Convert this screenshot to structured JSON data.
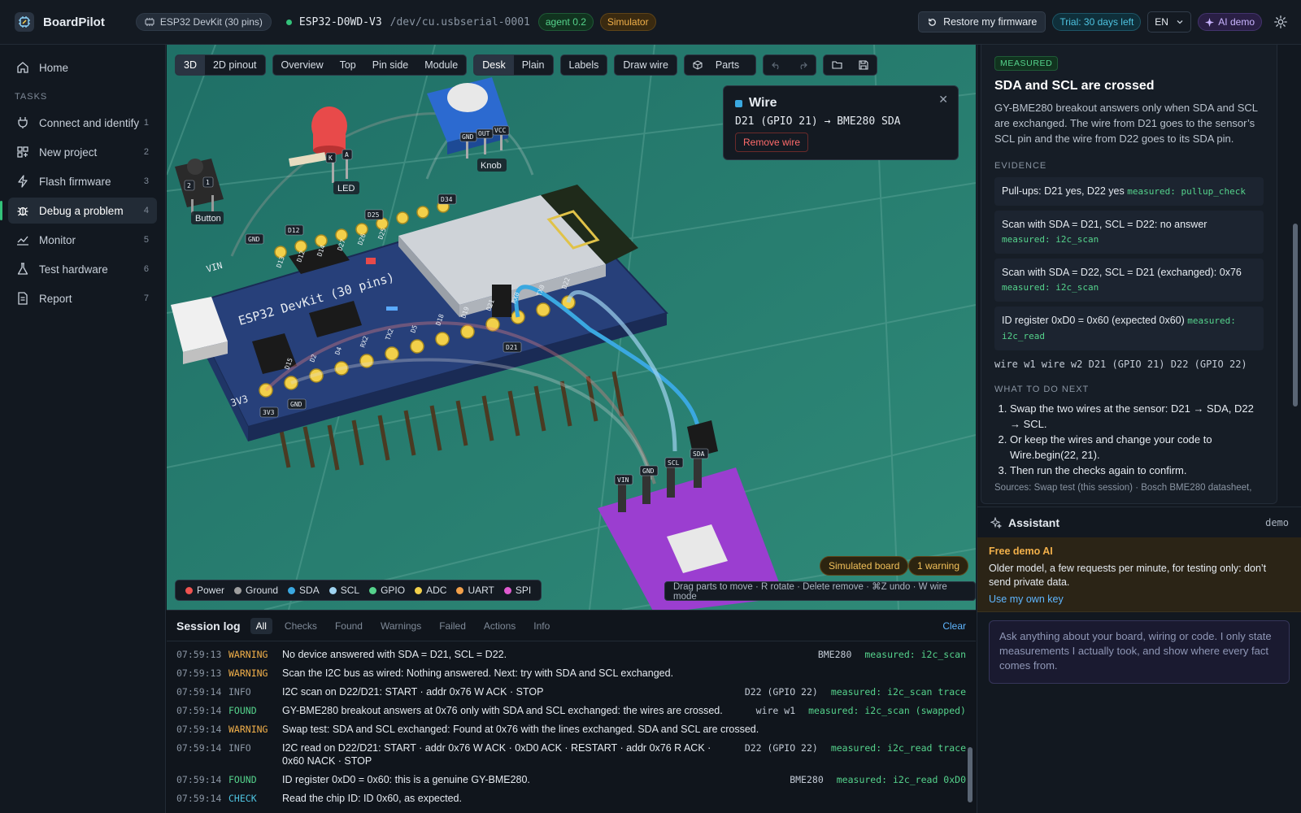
{
  "app": {
    "title": "BoardPilot"
  },
  "topbar": {
    "board": "ESP32 DevKit (30 pins)",
    "device": "ESP32-D0WD-V3",
    "port": "/dev/cu.usbserial-0001",
    "agent": "agent 0.2",
    "mode": "Simulator",
    "restore": "Restore my firmware",
    "trial": "Trial: 30 days left",
    "lang": "EN",
    "ai": "AI demo"
  },
  "sidebar": {
    "home": "Home",
    "section": "TASKS",
    "items": [
      {
        "label": "Connect and identify",
        "num": "1"
      },
      {
        "label": "New project",
        "num": "2"
      },
      {
        "label": "Flash firmware",
        "num": "3"
      },
      {
        "label": "Debug a problem",
        "num": "4"
      },
      {
        "label": "Monitor",
        "num": "5"
      },
      {
        "label": "Test hardware",
        "num": "6"
      },
      {
        "label": "Report",
        "num": "7"
      }
    ]
  },
  "toolbar": {
    "view": [
      "3D",
      "2D pinout"
    ],
    "camera": [
      "Overview",
      "Top",
      "Pin side",
      "Module"
    ],
    "bg": [
      "Desk",
      "Plain"
    ],
    "labels": "Labels",
    "draw": "Draw wire",
    "parts": "Parts"
  },
  "scene": {
    "board_label": "ESP32 DevKit (30 pins)",
    "parts": {
      "button": "Button",
      "led": "LED",
      "knob": "Knob"
    },
    "pins": [
      "GND",
      "D12",
      "D25",
      "D34",
      "D21",
      "3V3",
      "GND",
      "VIN",
      "GND",
      "SCL",
      "SDA",
      "K",
      "A",
      "GND",
      "OUT",
      "VCC",
      "2",
      "1"
    ],
    "silk": [
      "VIN",
      "D13",
      "D12",
      "D14",
      "D27",
      "D26",
      "D25",
      "3V3",
      "D15",
      "D2",
      "D4",
      "RX2",
      "TX2",
      "D5",
      "D18",
      "D19",
      "D21",
      "RX0",
      "TX0",
      "D22"
    ]
  },
  "wire_card": {
    "title": "Wire",
    "desc": "D21 (GPIO 21) → BME280 SDA",
    "remove": "Remove wire",
    "color": "#3aa8e0"
  },
  "legend": [
    {
      "name": "Power",
      "color": "#ef5350"
    },
    {
      "name": "Ground",
      "color": "#9e9e9e"
    },
    {
      "name": "SDA",
      "color": "#3aa8e0"
    },
    {
      "name": "SCL",
      "color": "#9fd3f0"
    },
    {
      "name": "GPIO",
      "color": "#55d38c"
    },
    {
      "name": "ADC",
      "color": "#f2d04a"
    },
    {
      "name": "UART",
      "color": "#f2a04a"
    },
    {
      "name": "SPI",
      "color": "#e05ad0"
    }
  ],
  "status": {
    "sim": "Simulated board",
    "warn": "1 warning",
    "hint": "Drag parts to move · R rotate · Delete remove · ⌘Z undo · W wire mode"
  },
  "log": {
    "title": "Session log",
    "filters": [
      "All",
      "Checks",
      "Found",
      "Warnings",
      "Failed",
      "Actions",
      "Info"
    ],
    "clear": "Clear",
    "rows": [
      {
        "t": "07:59:13",
        "lv": "WARNING",
        "msg": "No device answered with SDA = D21, SCL = D22.",
        "ref": "BME280",
        "src": "measured: i2c_scan"
      },
      {
        "t": "07:59:13",
        "lv": "WARNING",
        "msg": "Scan the I2C bus as wired: Nothing answered. Next: try with SDA and SCL exchanged.",
        "ref": "",
        "src": ""
      },
      {
        "t": "07:59:14",
        "lv": "INFO",
        "msg": "I2C scan on D22/D21: START · addr 0x76 W ACK · STOP",
        "ref": "D22 (GPIO 22)",
        "src": "measured: i2c_scan trace"
      },
      {
        "t": "07:59:14",
        "lv": "FOUND",
        "msg": "GY-BME280 breakout answers at 0x76 only with SDA and SCL exchanged: the wires are crossed.",
        "ref": "wire w1",
        "src": "measured: i2c_scan (swapped)"
      },
      {
        "t": "07:59:14",
        "lv": "WARNING",
        "msg": "Swap test: SDA and SCL exchanged: Found at 0x76 with the lines exchanged. SDA and SCL are crossed.",
        "ref": "",
        "src": ""
      },
      {
        "t": "07:59:14",
        "lv": "INFO",
        "msg": "I2C read on D22/D21: START · addr 0x76 W ACK · 0xD0 ACK · RESTART · addr 0x76 R ACK · 0x60 NACK · STOP",
        "ref": "D22 (GPIO 22)",
        "src": "measured: i2c_read trace"
      },
      {
        "t": "07:59:14",
        "lv": "FOUND",
        "msg": "ID register 0xD0 = 0x60: this is a genuine GY-BME280.",
        "ref": "BME280",
        "src": "measured: i2c_read 0xD0"
      },
      {
        "t": "07:59:14",
        "lv": "CHECK",
        "msg": "Read the chip ID: ID 0x60, as expected.",
        "ref": "",
        "src": ""
      }
    ]
  },
  "finding": {
    "tag": "MEASURED",
    "title": "SDA and SCL are crossed",
    "lead": "GY-BME280 breakout answers only when SDA and SCL are exchanged. The wire from D21 goes to the sensor’s SCL pin and the wire from D22 goes to its SDA pin.",
    "evidence_label": "EVIDENCE",
    "evidence": [
      {
        "text": "Pull-ups: D21 yes, D22 yes",
        "m": "measured: pullup_check"
      },
      {
        "text": "Scan with SDA = D21, SCL = D22: no answer",
        "m": "measured: i2c_scan"
      },
      {
        "text": "Scan with SDA = D22, SCL = D21 (exchanged): 0x76",
        "m": "measured: i2c_scan"
      },
      {
        "text": "ID register 0xD0 = 0x60 (expected 0x60)",
        "m": "measured: i2c_read"
      }
    ],
    "wires": "wire w1 wire w2 D21 (GPIO 21) D22 (GPIO 22)",
    "next_label": "WHAT TO DO NEXT",
    "next": [
      "Swap the two wires at the sensor: D21 → SDA, D22 → SCL.",
      "Or keep the wires and change your code to Wire.begin(22, 21).",
      "Then run the checks again to confirm."
    ],
    "sources": "Sources: Swap test (this session) · Bosch BME280 datasheet,"
  },
  "assistant": {
    "title": "Assistant",
    "mode": "demo",
    "demo_title": "Free demo AI",
    "demo_text": "Older model, a few requests per minute, for testing only: don’t send private data.",
    "own_key": "Use my own key",
    "placeholder": "Ask anything about your board, wiring or code. I only state measurements I actually took, and show where every fact comes from."
  }
}
